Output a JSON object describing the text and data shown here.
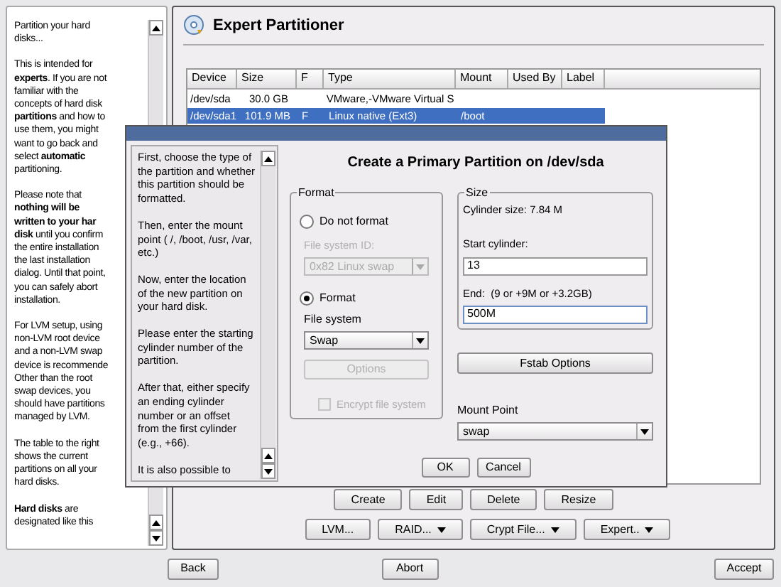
{
  "help": {
    "paragraphs": [
      [
        "Partition your hard",
        "disks..."
      ],
      [
        "This is intended for",
        "**experts**. If you are not",
        "familiar with the",
        "concepts of hard disk",
        "**partitions** and how to",
        "use them, you might",
        "want to go back and",
        "select **automatic**",
        "partitioning."
      ],
      [
        "Please note that",
        "**nothing will be**",
        "**written to your har**",
        "**disk** until you confirm",
        "the entire installation",
        "the last installation",
        "dialog. Until that point,",
        "you can safely abort",
        "installation."
      ],
      [
        "For LVM setup, using",
        "non-LVM root device",
        "and a non-LVM swap",
        "device is recommende",
        "Other than the root",
        "swap devices, you",
        "should have partitions",
        "managed by LVM."
      ],
      [
        "The table to the right",
        "shows the current",
        "partitions on all your",
        "hard disks."
      ],
      [
        "**Hard disks** are",
        "designated like this"
      ]
    ]
  },
  "main": {
    "title": "Expert Partitioner",
    "table": {
      "columns": [
        "Device",
        "Size",
        "F",
        "Type",
        "Mount",
        "Used By",
        "Label"
      ],
      "rows": [
        {
          "cells": [
            "/dev/sda",
            "30.0 GB",
            "",
            "VMware,-VMware Virtual S",
            "",
            "",
            ""
          ],
          "selected": false
        },
        {
          "cells": [
            "/dev/sda1",
            "101.9 MB",
            "F",
            "Linux native (Ext3)",
            "/boot",
            "",
            ""
          ],
          "selected": true
        }
      ]
    },
    "buttons": [
      {
        "label": "Create",
        "menu": false
      },
      {
        "label": "Edit",
        "menu": false
      },
      {
        "label": "Delete",
        "menu": false
      },
      {
        "label": "Resize",
        "menu": false
      }
    ],
    "buttons_2": [
      {
        "label": "LVM...",
        "menu": false
      },
      {
        "label": "RAID...",
        "menu": true
      },
      {
        "label": "Crypt File...",
        "menu": true
      },
      {
        "label": "Expert..",
        "menu": true
      }
    ]
  },
  "dialog": {
    "title": "Create a Primary Partition on /dev/sda",
    "help": [
      [
        "First, choose the type of",
        "the partition and whether",
        "this partition should be",
        "formatted."
      ],
      [
        "Then, enter the mount",
        "point ( /, /boot, /usr, /var,",
        "etc.)"
      ],
      [
        "Now, enter the location",
        "of the new partition on",
        "your hard disk."
      ],
      [
        "Please enter the starting",
        "cylinder number of the",
        "partition."
      ],
      [
        "After that, either specify",
        "an ending cylinder",
        "number or an offset",
        "from the first cylinder",
        "(e.g., +66)."
      ],
      [
        "It is also possible to"
      ]
    ],
    "format": {
      "title": "Format",
      "options": [
        {
          "label": "Do not format",
          "selected": false
        },
        {
          "label": "Format",
          "selected": true
        }
      ],
      "fs_id": {
        "label": "File system ID:",
        "value": "0x82 Linux swap",
        "disabled": true
      },
      "fs": {
        "label": "File system",
        "value": "Swap",
        "disabled": false
      },
      "options_button": {
        "label": "Options",
        "disabled": true
      },
      "encrypt": {
        "label": "Encrypt file system",
        "checked": false,
        "disabled": true
      }
    },
    "size": {
      "title": "Size",
      "cylinder_size": "Cylinder size: 7.84 M",
      "start_label": "Start cylinder:",
      "start_value": "13",
      "end_label": "End:  (9 or +9M or +3.2GB)",
      "end_value": "500M"
    },
    "fstab_button": "Fstab Options",
    "mount": {
      "label": "Mount Point",
      "value": "swap"
    },
    "ok": "OK",
    "cancel": "Cancel"
  },
  "footer": {
    "back": "Back",
    "abort": "Abort",
    "accept": "Accept"
  }
}
